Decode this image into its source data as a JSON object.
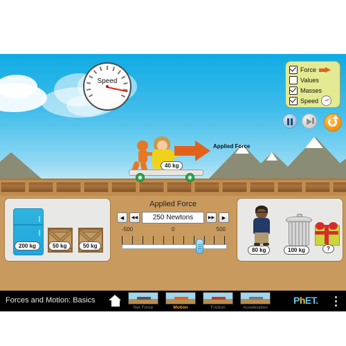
{
  "sim": {
    "name": "Forces and Motion: Basics",
    "active_tab": "Motion"
  },
  "speedometer": {
    "label": "Speed"
  },
  "scene": {
    "applied_force_arrow_label": "Applied Force",
    "rider_mass_label": "40 kg"
  },
  "checkbox_panel": {
    "items": [
      {
        "label": "Force",
        "checked": true,
        "icon": "arrow-icon"
      },
      {
        "label": "Values",
        "checked": false,
        "icon": ""
      },
      {
        "label": "Masses",
        "checked": true,
        "icon": ""
      },
      {
        "label": "Speed",
        "checked": true,
        "icon": "gauge-icon"
      }
    ]
  },
  "media_controls": {
    "pause_label": "Pause",
    "step_label": "Step Forward",
    "reset_label": "Reset"
  },
  "force_control": {
    "title": "Applied Force",
    "value_text": "250 Newtons",
    "buttons": {
      "left_small": "◀",
      "left_big": "◀◀",
      "right_big": "▶▶",
      "right_small": "▶"
    },
    "slider": {
      "min_label": "-500",
      "mid_label": "0",
      "max_label": "500",
      "min": -500,
      "max": 500,
      "value": 250,
      "tick_count": 11
    }
  },
  "left_object_panel": {
    "objects": [
      {
        "name": "refrigerator",
        "mass_label": "200 kg"
      },
      {
        "name": "crate-small-1",
        "mass_label": "50 kg"
      },
      {
        "name": "crate-small-2",
        "mass_label": "50 kg"
      }
    ]
  },
  "right_object_panel": {
    "objects": [
      {
        "name": "man",
        "mass_label": "80 kg"
      },
      {
        "name": "trash-can",
        "mass_label": "100 kg"
      },
      {
        "name": "mystery-gift",
        "mass_label": "?"
      }
    ]
  },
  "navbar": {
    "title": "Forces and Motion: Basics",
    "home_label": "Home",
    "tabs": [
      {
        "label": "Net Force",
        "active": false
      },
      {
        "label": "Motion",
        "active": true
      },
      {
        "label": "Friction",
        "active": false
      },
      {
        "label": "Acceleration",
        "active": false
      }
    ],
    "logo": {
      "part1": "P",
      "part2": "h",
      "part3": "ET."
    },
    "menu_label": "Menu"
  },
  "colors": {
    "sky": "#40bdeb",
    "ground": "#c99a5e",
    "accent_orange": "#e2621b",
    "panel_yellow": "#e3ea92",
    "active_tab": "#f5a623"
  }
}
